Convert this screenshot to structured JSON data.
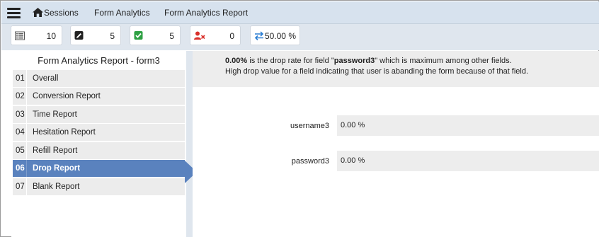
{
  "nav": {
    "sessions": "Sessions",
    "form_analytics": "Form Analytics",
    "form_analytics_report": "Form Analytics Report"
  },
  "stats": [
    {
      "icon": "list-icon",
      "value": "10",
      "color": "#555555"
    },
    {
      "icon": "edit-icon",
      "value": "5",
      "color": "#222222"
    },
    {
      "icon": "check-icon",
      "value": "5",
      "color": "#2ea043"
    },
    {
      "icon": "user-remove-icon",
      "value": "0",
      "color": "#d9302b"
    },
    {
      "icon": "transfer-arrows-icon",
      "value": "50.00 %",
      "color": "#2d7fd3"
    }
  ],
  "report": {
    "title": "Form Analytics Report - form3",
    "menu": [
      {
        "num": "01",
        "label": "Overall"
      },
      {
        "num": "02",
        "label": "Conversion Report"
      },
      {
        "num": "03",
        "label": "Time Report"
      },
      {
        "num": "04",
        "label": "Hesitation Report"
      },
      {
        "num": "05",
        "label": "Refill Report"
      },
      {
        "num": "06",
        "label": "Drop Report"
      },
      {
        "num": "07",
        "label": "Blank Report"
      }
    ],
    "active_index": 5
  },
  "info": {
    "rate": "0.00%",
    "line1_mid": " is the drop rate for field \"",
    "field": "password3",
    "line1_end": "\" which is maximum among other fields.",
    "line2": "High drop value for a field indicating that user is abanding the form because of that field."
  },
  "fields": [
    {
      "name": "username3",
      "value": "0.00 %"
    },
    {
      "name": "password3",
      "value": "0.00 %"
    }
  ],
  "colors": {
    "accent": "#5a82be",
    "nav_bg": "#d7e2ee",
    "stats_bg": "#dfe6ee"
  }
}
